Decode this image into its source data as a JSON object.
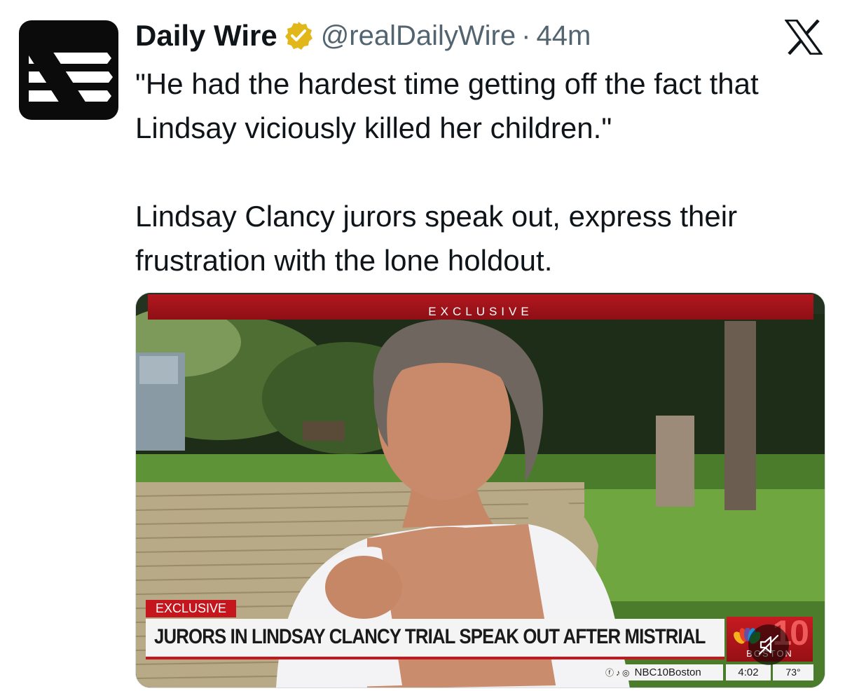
{
  "tweet": {
    "author": {
      "display_name": "Daily Wire",
      "handle": "@realDailyWire",
      "separator": "·",
      "time": "44m",
      "verified_badge": "gold-verified-badge-icon",
      "avatar": "daily-wire-logo"
    },
    "platform_icon": "x-logo-icon",
    "text_paragraphs": [
      "\"He had the hardest time getting off the fact that Lindsay viciously killed her children.\"",
      "Lindsay Clancy jurors speak out, express their frustration with the lone holdout."
    ]
  },
  "media": {
    "type": "video",
    "top_banner": "EXCLUSIVE",
    "lower_third": {
      "tag": "EXCLUSIVE",
      "headline": "JURORS IN LINDSAY CLANCY TRIAL SPEAK OUT AFTER MISTRIAL",
      "station_number": "10",
      "station_city": "BOSTON",
      "social_handle": "NBC10Boston",
      "social_icons": [
        "facebook-icon",
        "tiktok-icon",
        "instagram-icon"
      ],
      "time": "4:02",
      "temperature": "73°"
    },
    "mute_button": "muted-speaker-icon",
    "colors": {
      "news_red": "#c4161c",
      "lower_third_bg": "#f4f4f4",
      "verified_gold": "#e2b719"
    }
  }
}
